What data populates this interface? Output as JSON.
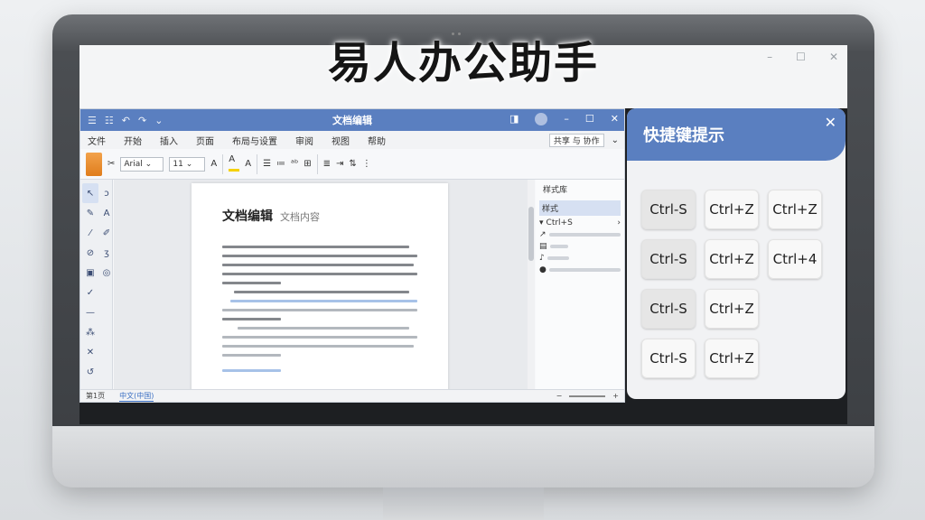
{
  "banner": {
    "title": "易人办公助手"
  },
  "top_controls": [
    "–",
    "☐",
    "✕"
  ],
  "editor": {
    "window_title": "文档编辑",
    "quick_access": [
      "☰",
      "☷",
      "↶",
      "↷",
      "⌄"
    ],
    "window_controls": [
      "◨",
      "–",
      "☐",
      "✕"
    ],
    "menu": [
      "文件",
      "开始",
      "插入",
      "页面",
      "布局与设置",
      "审阅",
      "视图",
      "帮助"
    ],
    "menu_right_box": "共享 与 协作",
    "ribbon": {
      "font_name": "Arial",
      "font_size": "11",
      "font_grow": "A",
      "font_color": "A"
    },
    "document": {
      "heading": "文档编辑",
      "subheading": "文档内容"
    },
    "status": {
      "left": "第1页",
      "lang": "中文(中国)",
      "zoom_minus": "−",
      "zoom_plus": "+"
    },
    "side_pane": {
      "header": "样式库",
      "selected": "样式",
      "item": "Ctrl+S"
    }
  },
  "panel": {
    "title": "快捷键提示",
    "close": "✕",
    "keys": [
      {
        "label": "Ctrl-S",
        "style": "grey"
      },
      {
        "label": "Ctrl+Z",
        "style": "white"
      },
      {
        "label": "Ctrl+Z",
        "style": "white"
      },
      {
        "label": "Ctrl-S",
        "style": "grey"
      },
      {
        "label": "Ctrl+Z",
        "style": "white"
      },
      {
        "label": "Ctrl+4",
        "style": "white"
      },
      {
        "label": "Ctrl-S",
        "style": "grey"
      },
      {
        "label": "Ctrl+Z",
        "style": "white"
      },
      {
        "label": "",
        "style": "none"
      },
      {
        "label": "Ctrl-S",
        "style": "white"
      },
      {
        "label": "Ctrl+Z",
        "style": "white"
      },
      {
        "label": "",
        "style": "none"
      }
    ]
  },
  "colors": {
    "accent": "#5a7fc0",
    "bezel": "#3b3e42"
  }
}
